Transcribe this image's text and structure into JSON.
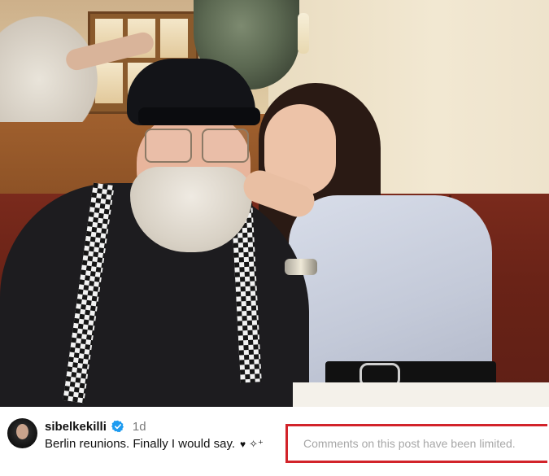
{
  "post": {
    "username": "sibelkekilli",
    "timestamp": "1d",
    "caption": "Berlin reunions. Finally I would say.",
    "emoji_heart": "♥",
    "emoji_sparkles": "✧⁺",
    "comments_notice": "Comments on this post have been limited.",
    "photo_icon": "post-photo",
    "verified_icon": "verified-badge-icon"
  },
  "colors": {
    "verified_blue": "#1d9bf0",
    "highlight_red": "#d2232a",
    "notice_gray": "#a7a7a7"
  }
}
